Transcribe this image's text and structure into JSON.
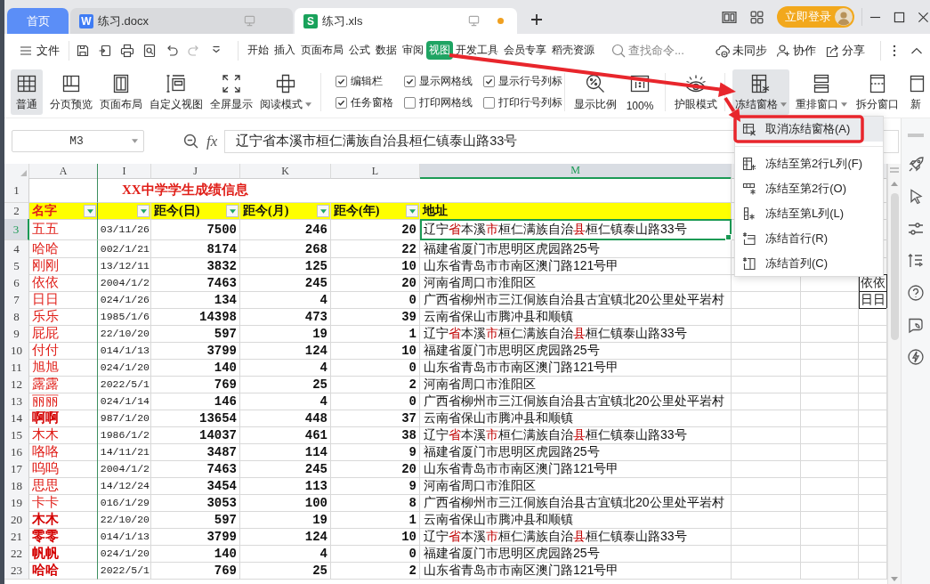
{
  "tabs": [
    {
      "label": "首页",
      "kind": "home",
      "selected": false
    },
    {
      "label": "练习.docx",
      "kind": "document",
      "logo": "W",
      "selected": false,
      "unsaved": false
    },
    {
      "label": "练习.xls",
      "kind": "spreadsheet",
      "logo": "S",
      "selected": true,
      "unsaved": true
    }
  ],
  "account": {
    "login": "立即登录"
  },
  "menu": {
    "file": "文件",
    "tabs": [
      {
        "label": "开始",
        "selected": false
      },
      {
        "label": "插入",
        "selected": false
      },
      {
        "label": "页面布局",
        "selected": false
      },
      {
        "label": "公式",
        "selected": false
      },
      {
        "label": "数据",
        "selected": false
      },
      {
        "label": "审阅",
        "selected": false
      },
      {
        "label": "视图",
        "selected": true
      },
      {
        "label": "开发工具",
        "selected": false
      },
      {
        "label": "会员专享",
        "selected": false
      },
      {
        "label": "稻壳资源",
        "selected": false
      }
    ],
    "search": {
      "placeholder": "查找命令..."
    },
    "actions": [
      "未同步",
      "协作",
      "分享"
    ]
  },
  "ribbon": {
    "views": [
      {
        "label": "普通",
        "selected": true,
        "dropdown": false
      },
      {
        "label": "分页预览",
        "selected": false,
        "dropdown": false
      },
      {
        "label": "页面布局",
        "selected": false,
        "dropdown": false
      },
      {
        "label": "自定义视图",
        "selected": false,
        "dropdown": false
      },
      {
        "label": "全屏显示",
        "selected": false,
        "dropdown": false
      },
      {
        "label": "阅读模式",
        "selected": false,
        "dropdown": true
      }
    ],
    "options": [
      {
        "label": "编辑栏",
        "checked": true
      },
      {
        "label": "任务窗格",
        "checked": true
      },
      {
        "label": "显示网格线",
        "checked": true
      },
      {
        "label": "打印网格线",
        "checked": false
      },
      {
        "label": "显示行号列标",
        "checked": true
      },
      {
        "label": "打印行号列标",
        "checked": false
      }
    ],
    "zoom": [
      {
        "label": "显示比例"
      },
      {
        "label": "100%"
      }
    ],
    "eye_care": "护眼模式",
    "window": [
      {
        "label": "冻结窗格",
        "selected": true,
        "dropdown": true
      },
      {
        "label": "重排窗口",
        "selected": false,
        "dropdown": true
      },
      {
        "label": "拆分窗口",
        "selected": false,
        "dropdown": false
      },
      {
        "label": "新",
        "selected": false,
        "dropdown": false
      }
    ]
  },
  "formula_bar": {
    "name_box": "M3",
    "fx": "fx",
    "value": "辽宁省本溪市桓仁满族自治县桓仁镇泰山路33号"
  },
  "sheet": {
    "columns": [
      {
        "label": "A",
        "selected": false
      },
      {
        "label": "I",
        "selected": false
      },
      {
        "label": "J",
        "selected": false
      },
      {
        "label": "K",
        "selected": false
      },
      {
        "label": "L",
        "selected": false
      },
      {
        "label": "M",
        "selected": true
      }
    ],
    "title": {
      "row": "1",
      "text": "XX中学学生成绩信息"
    },
    "header": {
      "row": "2",
      "cells": [
        {
          "label": "名字",
          "filter": true
        },
        {
          "filter": true
        },
        {
          "label": "距今(日)",
          "filter": true
        },
        {
          "label": "距今(月)",
          "filter": true
        },
        {
          "label": "距今(年)",
          "filter": true
        },
        {
          "label": "地址",
          "filter": false
        }
      ]
    },
    "rows": [
      {
        "row": "3",
        "selected": true,
        "name": "五五",
        "bold": false,
        "date": "03/11/26",
        "days": "7500",
        "months": "246",
        "years": "20",
        "address": [
          {
            "text": "辽宁",
            "highlight": false
          },
          {
            "text": "省",
            "highlight": true
          },
          {
            "text": "本溪",
            "highlight": false
          },
          {
            "text": "市",
            "highlight": true
          },
          {
            "text": "桓仁满族自治",
            "highlight": false
          },
          {
            "text": "县",
            "highlight": true
          },
          {
            "text": "桓仁镇泰山路33号",
            "highlight": false
          }
        ]
      },
      {
        "row": "4",
        "selected": false,
        "name": "哈哈",
        "bold": false,
        "date": "002/1/21",
        "days": "8174",
        "months": "268",
        "years": "22",
        "address": [
          {
            "text": "福建省厦门市思明区虎园路25号",
            "highlight": false
          }
        ]
      },
      {
        "row": "5",
        "selected": false,
        "name": "刚刚",
        "bold": false,
        "date": "13/12/11",
        "days": "3832",
        "months": "125",
        "years": "10",
        "address": [
          {
            "text": "山东省青岛市市南区澳门路121号甲",
            "highlight": false
          }
        ]
      },
      {
        "row": "6",
        "selected": false,
        "name": "依依",
        "bold": false,
        "date": "2004/1/2",
        "days": "7463",
        "months": "245",
        "years": "20",
        "address": [
          {
            "text": "河南省周口市淮阳区",
            "highlight": false
          }
        ],
        "side_cell": "依依"
      },
      {
        "row": "7",
        "selected": false,
        "name": "日日",
        "bold": false,
        "date": "024/1/26",
        "days": "134",
        "months": "4",
        "years": "0",
        "address": [
          {
            "text": "广西省柳州市三江侗族自治县古宜镇北20公里处平岩村",
            "highlight": false
          }
        ],
        "side_cell": "日日"
      },
      {
        "row": "8",
        "selected": false,
        "name": "乐乐",
        "bold": false,
        "date": "1985/1/6",
        "days": "14398",
        "months": "473",
        "years": "39",
        "address": [
          {
            "text": "云南省保山市腾冲县和顺镇",
            "highlight": false
          }
        ]
      },
      {
        "row": "9",
        "selected": false,
        "name": "屁屁",
        "bold": false,
        "date": "22/10/20",
        "days": "597",
        "months": "19",
        "years": "1",
        "address": [
          {
            "text": "辽宁",
            "highlight": false
          },
          {
            "text": "省",
            "highlight": true
          },
          {
            "text": "本溪",
            "highlight": false
          },
          {
            "text": "市",
            "highlight": true
          },
          {
            "text": "桓仁满族自治",
            "highlight": false
          },
          {
            "text": "县",
            "highlight": true
          },
          {
            "text": "桓仁镇泰山路33号",
            "highlight": false
          }
        ]
      },
      {
        "row": "10",
        "selected": false,
        "name": "付付",
        "bold": false,
        "date": "014/1/13",
        "days": "3799",
        "months": "124",
        "years": "10",
        "address": [
          {
            "text": "福建省厦门市思明区虎园路25号",
            "highlight": false
          }
        ]
      },
      {
        "row": "11",
        "selected": false,
        "name": "旭旭",
        "bold": false,
        "date": "024/1/20",
        "days": "140",
        "months": "4",
        "years": "0",
        "address": [
          {
            "text": "山东省青岛市市南区澳门路121号甲",
            "highlight": false
          }
        ]
      },
      {
        "row": "12",
        "selected": false,
        "name": "露露",
        "bold": false,
        "date": "2022/5/1",
        "days": "769",
        "months": "25",
        "years": "2",
        "address": [
          {
            "text": "河南省周口市淮阳区",
            "highlight": false
          }
        ]
      },
      {
        "row": "13",
        "selected": false,
        "name": "丽丽",
        "bold": false,
        "date": "024/1/14",
        "days": "146",
        "months": "4",
        "years": "0",
        "address": [
          {
            "text": "广西省柳州市三江侗族自治县古宜镇北20公里处平岩村",
            "highlight": false
          }
        ]
      },
      {
        "row": "14",
        "selected": false,
        "name": "啊啊",
        "bold": true,
        "date": "987/1/20",
        "days": "13654",
        "months": "448",
        "years": "37",
        "address": [
          {
            "text": "云南省保山市腾冲县和顺镇",
            "highlight": false
          }
        ]
      },
      {
        "row": "15",
        "selected": false,
        "name": "木木",
        "bold": false,
        "date": "1986/1/2",
        "days": "14037",
        "months": "461",
        "years": "38",
        "address": [
          {
            "text": "辽宁",
            "highlight": false
          },
          {
            "text": "省",
            "highlight": true
          },
          {
            "text": "本溪",
            "highlight": false
          },
          {
            "text": "市",
            "highlight": true
          },
          {
            "text": "桓仁满族自治",
            "highlight": false
          },
          {
            "text": "县",
            "highlight": true
          },
          {
            "text": "桓仁镇泰山路33号",
            "highlight": false
          }
        ]
      },
      {
        "row": "16",
        "selected": false,
        "name": "咯咯",
        "bold": false,
        "date": "14/11/21",
        "days": "3487",
        "months": "114",
        "years": "9",
        "address": [
          {
            "text": "福建省厦门市思明区虎园路25号",
            "highlight": false
          }
        ]
      },
      {
        "row": "17",
        "selected": false,
        "name": "呜呜",
        "bold": false,
        "date": "2004/1/2",
        "days": "7463",
        "months": "245",
        "years": "20",
        "address": [
          {
            "text": "山东省青岛市市南区澳门路121号甲",
            "highlight": false
          }
        ]
      },
      {
        "row": "18",
        "selected": false,
        "name": "思思",
        "bold": false,
        "date": "14/12/24",
        "days": "3454",
        "months": "113",
        "years": "9",
        "address": [
          {
            "text": "河南省周口市淮阳区",
            "highlight": false
          }
        ]
      },
      {
        "row": "19",
        "selected": false,
        "name": "卡卡",
        "bold": false,
        "date": "016/1/29",
        "days": "3053",
        "months": "100",
        "years": "8",
        "address": [
          {
            "text": "广西省柳州市三江侗族自治县古宜镇北20公里处平岩村",
            "highlight": false
          }
        ]
      },
      {
        "row": "20",
        "selected": false,
        "name": "木木",
        "bold": true,
        "date": "22/10/20",
        "days": "597",
        "months": "19",
        "years": "1",
        "address": [
          {
            "text": "云南省保山市腾冲县和顺镇",
            "highlight": false
          }
        ]
      },
      {
        "row": "21",
        "selected": false,
        "name": "零零",
        "bold": true,
        "date": "014/1/13",
        "days": "3799",
        "months": "124",
        "years": "10",
        "address": [
          {
            "text": "辽宁",
            "highlight": false
          },
          {
            "text": "省",
            "highlight": true
          },
          {
            "text": "本溪",
            "highlight": false
          },
          {
            "text": "市",
            "highlight": true
          },
          {
            "text": "桓仁满族自治",
            "highlight": false
          },
          {
            "text": "县",
            "highlight": true
          },
          {
            "text": "桓仁镇泰山路33号",
            "highlight": false
          }
        ]
      },
      {
        "row": "22",
        "selected": false,
        "name": "帆帆",
        "bold": true,
        "date": "024/1/20",
        "days": "140",
        "months": "4",
        "years": "0",
        "address": [
          {
            "text": "福建省厦门市思明区虎园路25号",
            "highlight": false
          }
        ]
      },
      {
        "row": "23",
        "selected": false,
        "name": "哈哈",
        "bold": true,
        "date": "2022/5/1",
        "days": "769",
        "months": "25",
        "years": "2",
        "address": [
          {
            "text": "山东省青岛市市南区澳门路121号甲",
            "highlight": false
          }
        ]
      }
    ]
  },
  "freeze_menu": {
    "items": [
      {
        "label": "取消冻结窗格(A)",
        "selected": true
      },
      {
        "label": "冻结至第2行L列(F)",
        "selected": false
      },
      {
        "label": "冻结至第2行(O)",
        "selected": false
      },
      {
        "label": "冻结至第L列(L)",
        "selected": false
      },
      {
        "label": "冻结首行(R)",
        "selected": false
      },
      {
        "label": "冻结首列(C)",
        "selected": false
      }
    ]
  }
}
